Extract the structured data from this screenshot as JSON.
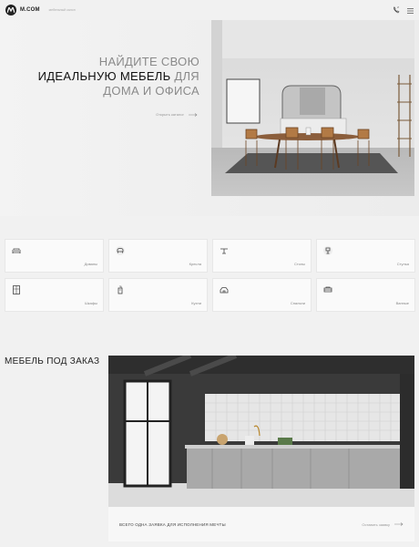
{
  "header": {
    "logo_text": "M.COM",
    "tagline": "мебельный салон",
    "phone_icon": "phone-icon",
    "menu_icon": "menu-icon"
  },
  "hero": {
    "title_line1": "НАЙДИТЕ СВОЮ",
    "title_line2_strong": "ИДЕАЛЬНУЮ МЕБЕЛЬ",
    "title_line2_rest": " ДЛЯ",
    "title_line3": "ДОМА И ОФИСА",
    "link_label": "Открыть каталог"
  },
  "categories": [
    {
      "label": "Диваны",
      "icon": "sofa-icon"
    },
    {
      "label": "Кресла",
      "icon": "armchair-icon"
    },
    {
      "label": "Столы",
      "icon": "table-icon"
    },
    {
      "label": "Стулья",
      "icon": "chair-icon"
    },
    {
      "label": "Шкафы",
      "icon": "wardrobe-icon"
    },
    {
      "label": "Кухни",
      "icon": "kitchen-icon"
    },
    {
      "label": "Спальни",
      "icon": "bedroom-icon"
    },
    {
      "label": "Ванные",
      "icon": "bath-icon"
    }
  ],
  "custom": {
    "title": "МЕБЕЛЬ ПОД ЗАКАЗ",
    "note": "ВСЕГО ОДНА ЗАЯВКА ДЛЯ ИСПОЛНЕНИЯ МЕЧТЫ",
    "link_label": "Оставить заявку"
  },
  "colors": {
    "accent": "#222222",
    "background": "#f1f1f1"
  }
}
